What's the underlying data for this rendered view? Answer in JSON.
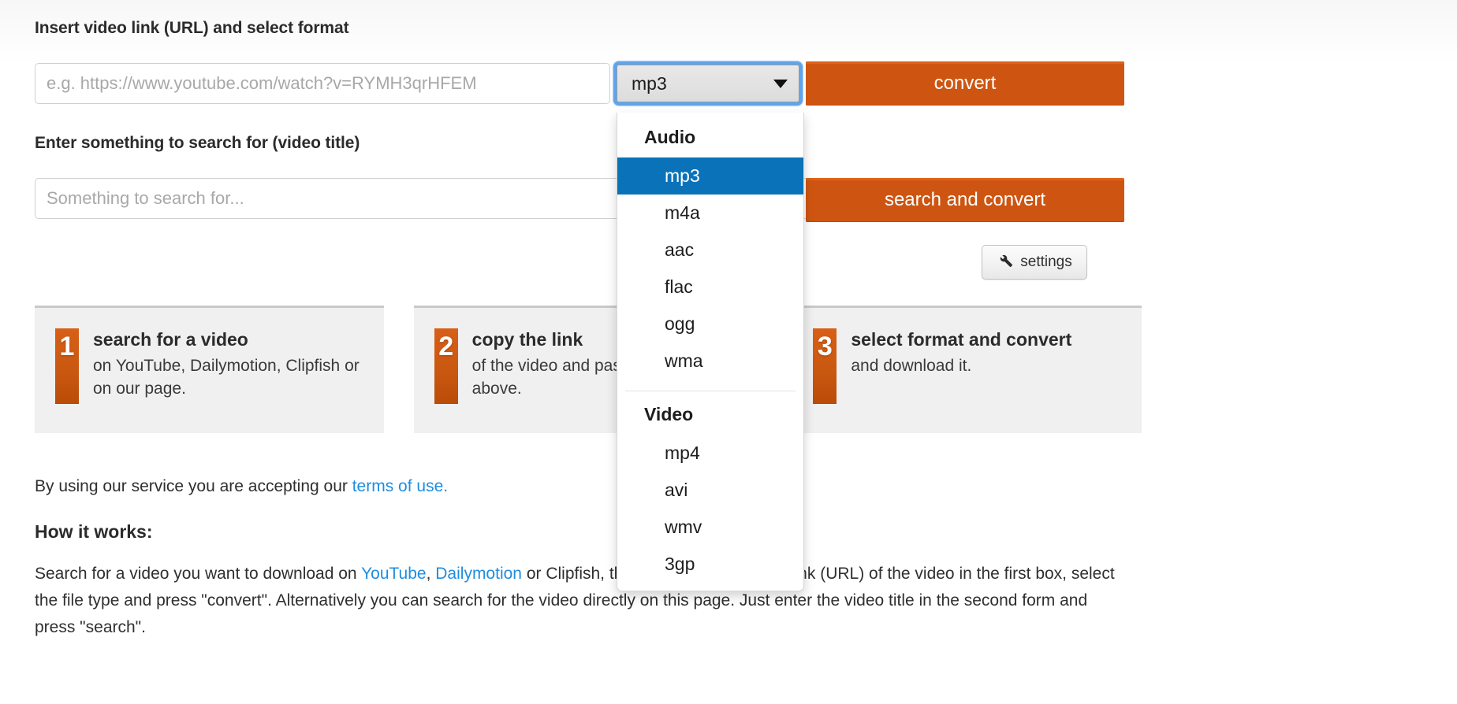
{
  "form": {
    "url_label": "Insert video link (URL) and select format",
    "url_placeholder": "e.g. https://www.youtube.com/watch?v=RYMH3qrHFEM",
    "search_label": "Enter something to search for (video title)",
    "search_placeholder": "Something to search for...",
    "url_value": "",
    "search_value": "",
    "convert_button": "convert",
    "search_convert_button": "search and convert",
    "settings_button": "settings"
  },
  "format_select": {
    "selected": "mp3",
    "caret_icon": "chevron-down-icon",
    "focused": true,
    "groups": [
      {
        "label": "Audio",
        "options": [
          "mp3",
          "m4a",
          "aac",
          "flac",
          "ogg",
          "wma"
        ]
      },
      {
        "label": "Video",
        "options": [
          "mp4",
          "avi",
          "wmv",
          "3gp"
        ]
      }
    ]
  },
  "steps": [
    {
      "number": "1",
      "title": "search for a video",
      "desc": "on YouTube, Dailymotion, Clipfish or on our page."
    },
    {
      "number": "2",
      "title": "copy the link",
      "desc": "of the video and paste it in the box above."
    },
    {
      "number": "3",
      "title": "select format and convert",
      "desc": "and download it."
    }
  ],
  "terms": {
    "prefix": "By using our service you are accepting our ",
    "link": "terms of use."
  },
  "how_it_works": {
    "title": "How it works:",
    "part1": "Search for a video you want to download on ",
    "link1": "YouTube",
    "part2": ", ",
    "link2": "Dailymotion",
    "part3": " or Clipfish, then copy and paste the link (URL) of the video in the first box, select the file type and press \"convert\". Alternatively you can search for the video directly on this page. Just enter the video title in the second form and press \"search\"."
  },
  "colors": {
    "accent_orange": "#ce5511",
    "highlight_blue": "#0a72b9",
    "focus_blue": "#5fa4ec",
    "link_blue": "#1f8ddf",
    "step_bg": "#f0f0f0"
  }
}
